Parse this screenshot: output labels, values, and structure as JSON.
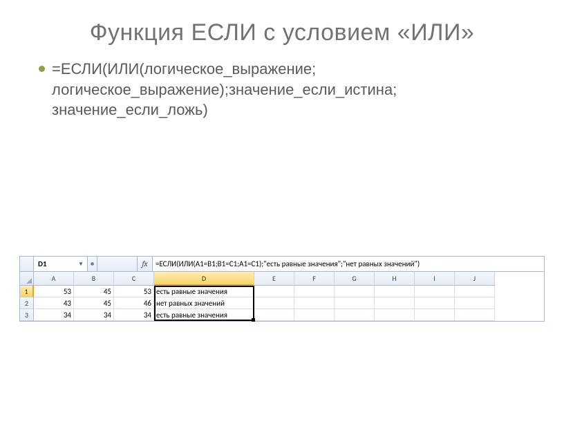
{
  "slide": {
    "title": "Функция ЕСЛИ с условием «ИЛИ»",
    "bullet": "=ЕСЛИ(ИЛИ(логическое_выражение; логическое_выражение);значение_если_истина; значение_если_ложь)"
  },
  "excel": {
    "name_box": "D1",
    "fx_label": "fx",
    "formula": "=ЕСЛИ(ИЛИ(A1=B1;B1=C1;A1=C1);\"есть равные значения\";\"нет равных значений\")",
    "columns": [
      "A",
      "B",
      "C",
      "D",
      "E",
      "F",
      "G",
      "H",
      "I",
      "J"
    ],
    "row_numbers": [
      "1",
      "2",
      "3"
    ],
    "active_col_index": 3,
    "active_row_index": 0,
    "rows": [
      {
        "A": "53",
        "B": "45",
        "C": "53",
        "D": "есть равные значения"
      },
      {
        "A": "43",
        "B": "45",
        "C": "46",
        "D": "нет равных значений"
      },
      {
        "A": "34",
        "B": "34",
        "C": "34",
        "D": "есть равные значения"
      }
    ]
  }
}
